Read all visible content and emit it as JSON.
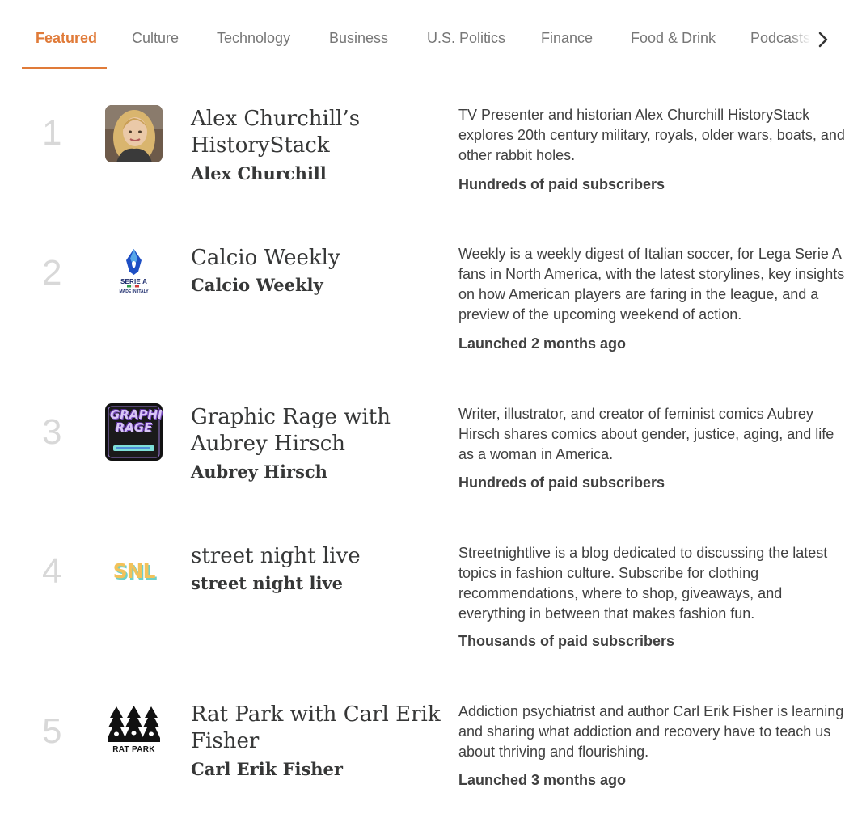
{
  "tabs": [
    {
      "label": "Featured",
      "active": true
    },
    {
      "label": "Culture"
    },
    {
      "label": "Technology"
    },
    {
      "label": "Business"
    },
    {
      "label": "U.S. Politics"
    },
    {
      "label": "Finance"
    },
    {
      "label": "Food & Drink"
    },
    {
      "label": "Podcasts"
    }
  ],
  "tabs_next_icon": "chevron-right-icon",
  "accent_color": "#e07b39",
  "publications": [
    {
      "rank": "1",
      "title": "Alex Churchill’s HistoryStack",
      "author": "Alex Churchill",
      "description": "TV Presenter and historian Alex Churchill HistoryStack explores 20th century military, royals, older wars, boats, and other rabbit holes.",
      "meta": "Hundreds of paid subscribers",
      "logo": "avatar-photo"
    },
    {
      "rank": "2",
      "title": "Calcio Weekly",
      "author": "Calcio Weekly",
      "description": "Weekly is a weekly digest of Italian soccer, for Lega Serie A fans in North America, with the latest storylines, key insights on how American players are faring in the league, and a preview of the upcoming weekend of action.",
      "meta": "Launched 2 months ago",
      "logo": "serie-a-logo",
      "logo_text": "SERIE A",
      "logo_subtext": "MADE IN ITALY"
    },
    {
      "rank": "3",
      "title": "Graphic Rage with Aubrey Hirsch",
      "author": "Aubrey Hirsch",
      "description": "Writer, illustrator, and creator of feminist comics Aubrey Hirsch shares comics about gender, justice, aging, and life as a woman in America.",
      "meta": "Hundreds of paid subscribers",
      "logo": "graphic-rage-logo",
      "logo_text": "GRAPHIC RAGE"
    },
    {
      "rank": "4",
      "title": "street night live",
      "author": "street night live",
      "description": "Streetnightlive is a blog dedicated to discussing the latest topics in fashion culture. Subscribe for clothing recommendations, where to shop, giveaways, and everything in between that makes fashion fun.",
      "meta": "Thousands of paid subscribers",
      "logo": "snl-logo",
      "logo_text": "SNL"
    },
    {
      "rank": "5",
      "title": "Rat Park with Carl Erik Fisher",
      "author": "Carl Erik Fisher",
      "description": "Addiction psychiatrist and author Carl Erik Fisher is learning and sharing what addiction and recovery have to teach us about thriving and flourishing.",
      "meta": "Launched 3 months ago",
      "logo": "rat-park-logo",
      "logo_text": "RAT PARK"
    }
  ]
}
